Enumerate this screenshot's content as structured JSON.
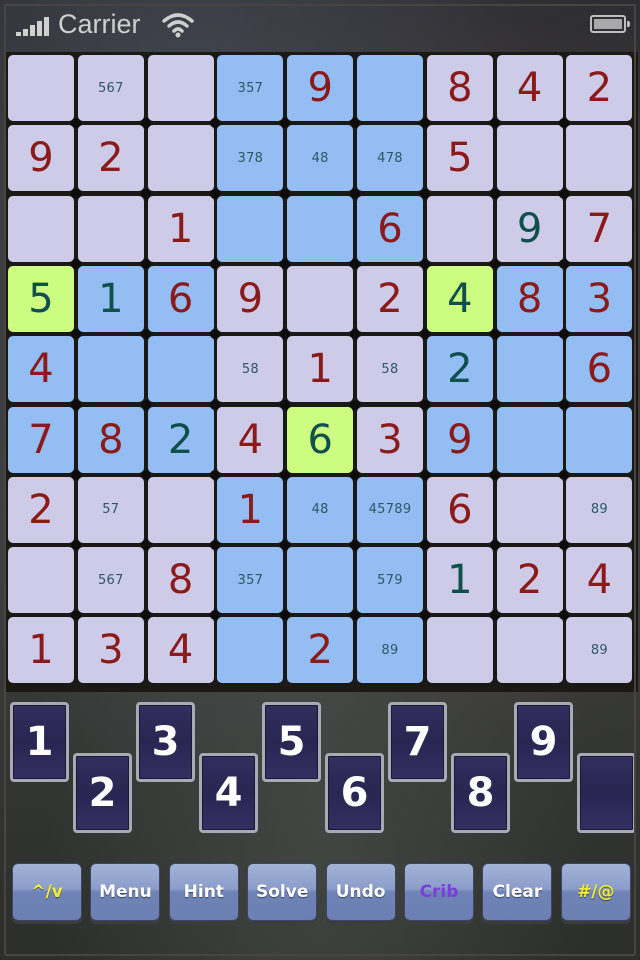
{
  "status_bar": {
    "carrier": "Carrier",
    "signal_icon": "signal-bars-icon",
    "wifi_icon": "wifi-icon",
    "battery_icon": "battery-icon"
  },
  "colors": {
    "cell_default": "#cdcbe7",
    "cell_highlight_blue": "#93bdf3",
    "cell_selected_green": "#ccfd80",
    "digit_given": "#8b1a1a",
    "digit_user": "#0f4f4c",
    "pencil_mark": "#2e5866",
    "key_bg": "#2a2652",
    "toolbar_bg": "#8a9cc9"
  },
  "board": {
    "rows": [
      [
        {
          "bg": "lav",
          "value": "",
          "kind": "",
          "pencil": ""
        },
        {
          "bg": "lav",
          "value": "",
          "kind": "",
          "pencil": "567"
        },
        {
          "bg": "lav",
          "value": "",
          "kind": "",
          "pencil": ""
        },
        {
          "bg": "blue",
          "value": "",
          "kind": "",
          "pencil": "357"
        },
        {
          "bg": "blue",
          "value": "9",
          "kind": "given",
          "pencil": ""
        },
        {
          "bg": "blue",
          "value": "",
          "kind": "",
          "pencil": ""
        },
        {
          "bg": "lav",
          "value": "8",
          "kind": "given",
          "pencil": ""
        },
        {
          "bg": "lav",
          "value": "4",
          "kind": "given",
          "pencil": ""
        },
        {
          "bg": "lav",
          "value": "2",
          "kind": "given",
          "pencil": ""
        }
      ],
      [
        {
          "bg": "lav",
          "value": "9",
          "kind": "given",
          "pencil": ""
        },
        {
          "bg": "lav",
          "value": "2",
          "kind": "given",
          "pencil": ""
        },
        {
          "bg": "lav",
          "value": "",
          "kind": "",
          "pencil": ""
        },
        {
          "bg": "blue",
          "value": "",
          "kind": "",
          "pencil": "378"
        },
        {
          "bg": "blue",
          "value": "",
          "kind": "",
          "pencil": "48"
        },
        {
          "bg": "blue",
          "value": "",
          "kind": "",
          "pencil": "478"
        },
        {
          "bg": "lav",
          "value": "5",
          "kind": "given",
          "pencil": ""
        },
        {
          "bg": "lav",
          "value": "",
          "kind": "",
          "pencil": ""
        },
        {
          "bg": "lav",
          "value": "",
          "kind": "",
          "pencil": ""
        }
      ],
      [
        {
          "bg": "lav",
          "value": "",
          "kind": "",
          "pencil": ""
        },
        {
          "bg": "lav",
          "value": "",
          "kind": "",
          "pencil": ""
        },
        {
          "bg": "lav",
          "value": "1",
          "kind": "given",
          "pencil": ""
        },
        {
          "bg": "blue",
          "value": "",
          "kind": "",
          "pencil": ""
        },
        {
          "bg": "blue",
          "value": "",
          "kind": "",
          "pencil": ""
        },
        {
          "bg": "blue",
          "value": "6",
          "kind": "given",
          "pencil": ""
        },
        {
          "bg": "lav",
          "value": "",
          "kind": "",
          "pencil": ""
        },
        {
          "bg": "lav",
          "value": "9",
          "kind": "user",
          "pencil": ""
        },
        {
          "bg": "lav",
          "value": "7",
          "kind": "given",
          "pencil": ""
        }
      ],
      [
        {
          "bg": "green",
          "value": "5",
          "kind": "user",
          "pencil": ""
        },
        {
          "bg": "blue",
          "value": "1",
          "kind": "user",
          "pencil": ""
        },
        {
          "bg": "blue",
          "value": "6",
          "kind": "given",
          "pencil": ""
        },
        {
          "bg": "lav",
          "value": "9",
          "kind": "given",
          "pencil": ""
        },
        {
          "bg": "lav",
          "value": "",
          "kind": "",
          "pencil": ""
        },
        {
          "bg": "lav",
          "value": "2",
          "kind": "given",
          "pencil": ""
        },
        {
          "bg": "green",
          "value": "4",
          "kind": "user",
          "pencil": ""
        },
        {
          "bg": "blue",
          "value": "8",
          "kind": "given",
          "pencil": ""
        },
        {
          "bg": "blue",
          "value": "3",
          "kind": "given",
          "pencil": ""
        }
      ],
      [
        {
          "bg": "blue",
          "value": "4",
          "kind": "given",
          "pencil": ""
        },
        {
          "bg": "blue",
          "value": "",
          "kind": "",
          "pencil": ""
        },
        {
          "bg": "blue",
          "value": "",
          "kind": "",
          "pencil": ""
        },
        {
          "bg": "lav",
          "value": "",
          "kind": "",
          "pencil": "58"
        },
        {
          "bg": "lav",
          "value": "1",
          "kind": "given",
          "pencil": ""
        },
        {
          "bg": "lav",
          "value": "",
          "kind": "",
          "pencil": "58"
        },
        {
          "bg": "blue",
          "value": "2",
          "kind": "user",
          "pencil": ""
        },
        {
          "bg": "blue",
          "value": "",
          "kind": "",
          "pencil": ""
        },
        {
          "bg": "blue",
          "value": "6",
          "kind": "given",
          "pencil": ""
        }
      ],
      [
        {
          "bg": "blue",
          "value": "7",
          "kind": "given",
          "pencil": ""
        },
        {
          "bg": "blue",
          "value": "8",
          "kind": "given",
          "pencil": ""
        },
        {
          "bg": "blue",
          "value": "2",
          "kind": "user",
          "pencil": ""
        },
        {
          "bg": "lav",
          "value": "4",
          "kind": "given",
          "pencil": ""
        },
        {
          "bg": "green",
          "value": "6",
          "kind": "user",
          "pencil": ""
        },
        {
          "bg": "lav",
          "value": "3",
          "kind": "given",
          "pencil": ""
        },
        {
          "bg": "blue",
          "value": "9",
          "kind": "given",
          "pencil": ""
        },
        {
          "bg": "blue",
          "value": "",
          "kind": "",
          "pencil": ""
        },
        {
          "bg": "blue",
          "value": "",
          "kind": "",
          "pencil": ""
        }
      ],
      [
        {
          "bg": "lav",
          "value": "2",
          "kind": "given",
          "pencil": ""
        },
        {
          "bg": "lav",
          "value": "",
          "kind": "",
          "pencil": "57"
        },
        {
          "bg": "lav",
          "value": "",
          "kind": "",
          "pencil": ""
        },
        {
          "bg": "blue",
          "value": "1",
          "kind": "given",
          "pencil": ""
        },
        {
          "bg": "blue",
          "value": "",
          "kind": "",
          "pencil": "48"
        },
        {
          "bg": "blue",
          "value": "",
          "kind": "",
          "pencil": "45789"
        },
        {
          "bg": "lav",
          "value": "6",
          "kind": "given",
          "pencil": ""
        },
        {
          "bg": "lav",
          "value": "",
          "kind": "",
          "pencil": ""
        },
        {
          "bg": "lav",
          "value": "",
          "kind": "",
          "pencil": "89"
        }
      ],
      [
        {
          "bg": "lav",
          "value": "",
          "kind": "",
          "pencil": ""
        },
        {
          "bg": "lav",
          "value": "",
          "kind": "",
          "pencil": "567"
        },
        {
          "bg": "lav",
          "value": "8",
          "kind": "given",
          "pencil": ""
        },
        {
          "bg": "blue",
          "value": "",
          "kind": "",
          "pencil": "357"
        },
        {
          "bg": "blue",
          "value": "",
          "kind": "",
          "pencil": ""
        },
        {
          "bg": "blue",
          "value": "",
          "kind": "",
          "pencil": "579"
        },
        {
          "bg": "lav",
          "value": "1",
          "kind": "user",
          "pencil": ""
        },
        {
          "bg": "lav",
          "value": "2",
          "kind": "given",
          "pencil": ""
        },
        {
          "bg": "lav",
          "value": "4",
          "kind": "given",
          "pencil": ""
        }
      ],
      [
        {
          "bg": "lav",
          "value": "1",
          "kind": "given",
          "pencil": ""
        },
        {
          "bg": "lav",
          "value": "3",
          "kind": "given",
          "pencil": ""
        },
        {
          "bg": "lav",
          "value": "4",
          "kind": "given",
          "pencil": ""
        },
        {
          "bg": "blue",
          "value": "",
          "kind": "",
          "pencil": ""
        },
        {
          "bg": "blue",
          "value": "2",
          "kind": "given",
          "pencil": ""
        },
        {
          "bg": "blue",
          "value": "",
          "kind": "",
          "pencil": "89"
        },
        {
          "bg": "lav",
          "value": "",
          "kind": "",
          "pencil": ""
        },
        {
          "bg": "lav",
          "value": "",
          "kind": "",
          "pencil": ""
        },
        {
          "bg": "lav",
          "value": "",
          "kind": "",
          "pencil": "89"
        }
      ]
    ]
  },
  "keypad": {
    "keys": [
      {
        "label": "1",
        "row": "up"
      },
      {
        "label": "2",
        "row": "down"
      },
      {
        "label": "3",
        "row": "up"
      },
      {
        "label": "4",
        "row": "down"
      },
      {
        "label": "5",
        "row": "up"
      },
      {
        "label": "6",
        "row": "down"
      },
      {
        "label": "7",
        "row": "up"
      },
      {
        "label": "8",
        "row": "down"
      },
      {
        "label": "9",
        "row": "up"
      },
      {
        "label": "",
        "row": "down"
      }
    ]
  },
  "toolbar": {
    "buttons": [
      {
        "label": "^/v",
        "style": "yellow",
        "name": "toggle-layout-button"
      },
      {
        "label": "Menu",
        "style": "",
        "name": "menu-button"
      },
      {
        "label": "Hint",
        "style": "",
        "name": "hint-button"
      },
      {
        "label": "Solve",
        "style": "",
        "name": "solve-button"
      },
      {
        "label": "Undo",
        "style": "",
        "name": "undo-button"
      },
      {
        "label": "Crib",
        "style": "purple",
        "name": "crib-button"
      },
      {
        "label": "Clear",
        "style": "",
        "name": "clear-button"
      },
      {
        "label": "#/@",
        "style": "yellow",
        "name": "input-mode-button"
      }
    ]
  }
}
